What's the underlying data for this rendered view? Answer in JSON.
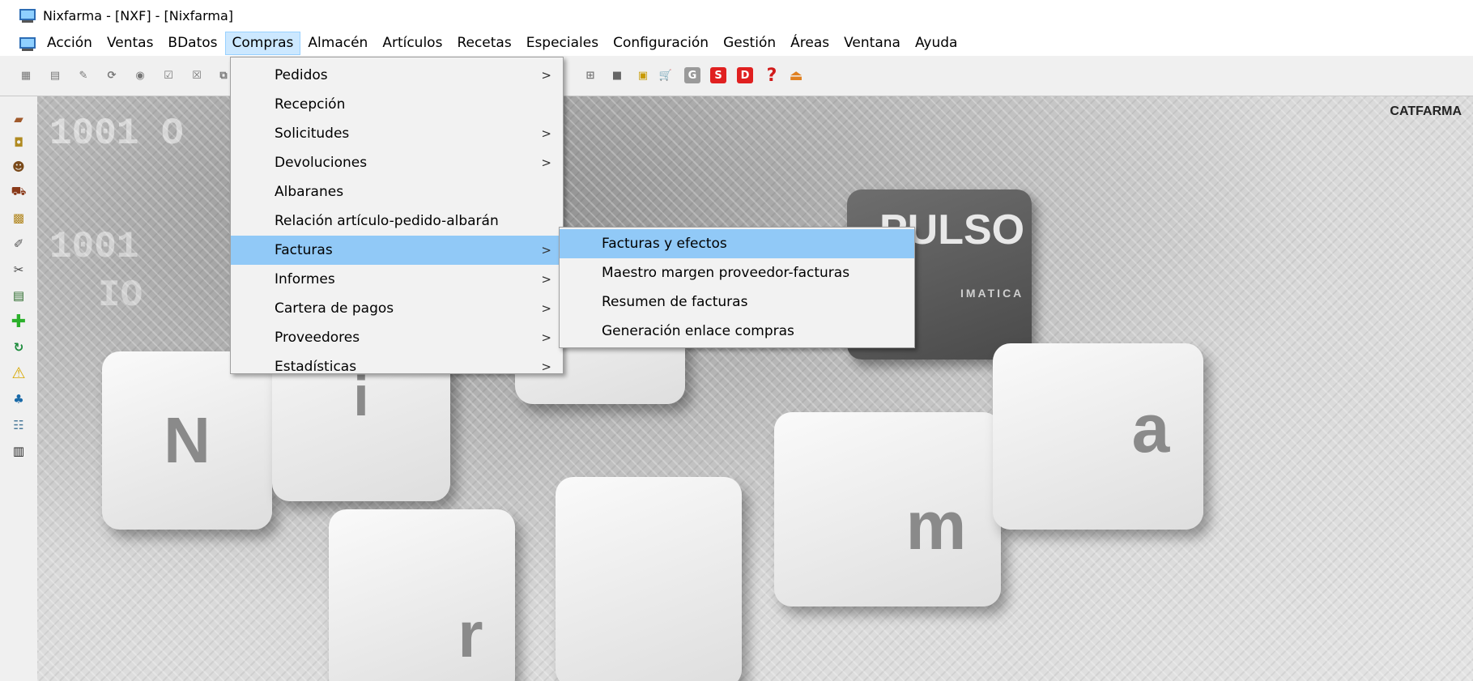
{
  "window": {
    "title": "Nixfarma - [NXF] - [Nixfarma]"
  },
  "menubar": {
    "items": [
      "Acción",
      "Ventas",
      "BDatos",
      "Compras",
      "Almacén",
      "Artículos",
      "Recetas",
      "Especiales",
      "Configuración",
      "Gestión",
      "Áreas",
      "Ventana",
      "Ayuda"
    ],
    "active": "Compras"
  },
  "toolbar": {
    "buttons": [
      {
        "icon": "grid-icon"
      },
      {
        "icon": "document-icon"
      },
      {
        "icon": "edit-icon"
      },
      {
        "icon": "refresh-icon"
      },
      {
        "icon": "binoculars-icon"
      },
      {
        "icon": "checklist-icon"
      },
      {
        "icon": "cancel-box-icon"
      },
      {
        "icon": "copy-icon"
      },
      {
        "icon": "network-icon"
      },
      {
        "icon": "stop-icon"
      },
      {
        "icon": "transfer-icon"
      },
      {
        "icon": "cart-icon"
      },
      {
        "label": "G",
        "color": "#9a9a9a"
      },
      {
        "label": "S",
        "color": "#e02020"
      },
      {
        "label": "D",
        "color": "#e02020"
      },
      {
        "label": "?",
        "color": "#d11a1a"
      },
      {
        "icon": "upload-box-icon",
        "color": "#e08020"
      }
    ]
  },
  "left_toolbar": {
    "icons": [
      "cash-register-icon",
      "card-icon",
      "customer-icon",
      "cart-icon",
      "boxes-icon",
      "pen-icon",
      "scissors-icon",
      "printer-icon",
      "add-cross-icon",
      "sync-icon",
      "warning-icon",
      "users-icon",
      "group-icon",
      "barcode-icon"
    ]
  },
  "workspace": {
    "brand_label": "CATFARMA",
    "background_text": {
      "key_n": "N",
      "key_i": "i",
      "key_m": "m",
      "key_r": "r",
      "key_a": "a",
      "pulso": "PULSO",
      "matica": "IMATICA",
      "binary_1": "1001 O",
      "binary_2": "1001",
      "binary_3": "IO"
    }
  },
  "compras_menu": {
    "items": [
      {
        "label": "Pedidos",
        "submenu": true
      },
      {
        "label": "Recepción",
        "submenu": false
      },
      {
        "label": "Solicitudes",
        "submenu": true
      },
      {
        "label": "Devoluciones",
        "submenu": true
      },
      {
        "label": "Albaranes",
        "submenu": false
      },
      {
        "label": "Relación artículo-pedido-albarán",
        "submenu": false
      },
      {
        "label": "Facturas",
        "submenu": true,
        "highlighted": true
      },
      {
        "label": "Informes",
        "submenu": true
      },
      {
        "label": "Cartera de pagos",
        "submenu": true
      },
      {
        "label": "Proveedores",
        "submenu": true
      },
      {
        "label": "Estadísticas",
        "submenu": true
      }
    ],
    "arrow": ">"
  },
  "facturas_submenu": {
    "items": [
      {
        "label": "Facturas y efectos",
        "highlighted": true
      },
      {
        "label": "Maestro margen proveedor-facturas"
      },
      {
        "label": "Resumen de facturas"
      },
      {
        "label": "Generación enlace compras"
      }
    ]
  }
}
